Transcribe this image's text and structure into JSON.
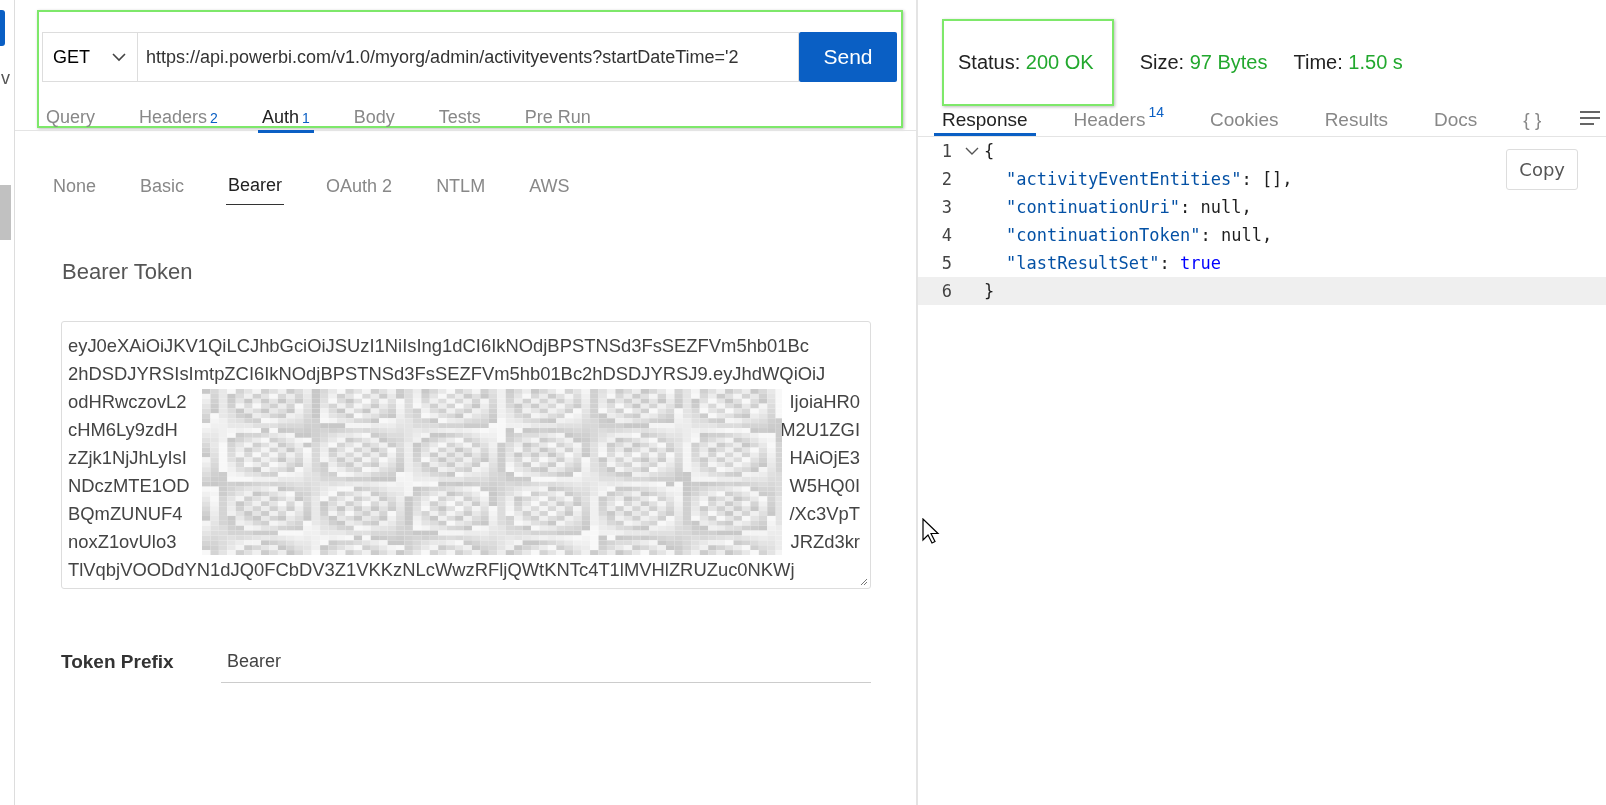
{
  "sidebar": {
    "text": "v"
  },
  "request": {
    "highlighted": true,
    "method": "GET",
    "url": "https://api.powerbi.com/v1.0/myorg/admin/activityevents?startDateTime='2",
    "send": "Send",
    "tabs": [
      {
        "label": "Query",
        "selected": false
      },
      {
        "label": "Headers",
        "badge": "2",
        "selected": false
      },
      {
        "label": "Auth",
        "badge": "1",
        "selected": true
      },
      {
        "label": "Body",
        "selected": false
      },
      {
        "label": "Tests",
        "selected": false
      },
      {
        "label": "Pre Run",
        "selected": false
      }
    ]
  },
  "auth": {
    "tabs": [
      {
        "label": "None",
        "selected": false
      },
      {
        "label": "Basic",
        "selected": false
      },
      {
        "label": "Bearer",
        "selected": true
      },
      {
        "label": "OAuth 2",
        "selected": false
      },
      {
        "label": "NTLM",
        "selected": false
      },
      {
        "label": "AWS",
        "selected": false
      }
    ],
    "title": "Bearer Token",
    "token_lines": [
      {
        "text": "eyJ0eXAiOiJKV1QiLCJhbGciOiJSUzI1NiIsIng1dCI6IkNOdjBPSTNSd3FsSEZFVm5hb01Bc"
      },
      {
        "text": "2hDSDJYRSIsImtpZCI6IkNOdjBPSTNSd3FsSEZFVm5hb01Bc2hDSDJYRSJ9.eyJhdWQiOiJ"
      },
      {
        "left": "odHRwczovL2",
        "right": "IjoiaHR0"
      },
      {
        "left": "cHM6Ly9zdH",
        "right": "M2U1ZGI"
      },
      {
        "left": "zZjk1NjJhLyIsI",
        "right": "HAiOjE3"
      },
      {
        "left": "NDczMTE1OD",
        "right": "W5HQ0I"
      },
      {
        "left": "BQmZUNUF4",
        "right": "/Xc3VpT"
      },
      {
        "left": "noxZ1ovUlo3",
        "right": "JRZd3kr"
      },
      {
        "text": "TlVqbjVOODdYN1dJQ0FCbDV3Z1VKKzNLcWwzRFljQWtKNTc4T1lMVHlZRUZuc0NKWj"
      }
    ],
    "prefix_label": "Token Prefix",
    "prefix_value": "Bearer"
  },
  "response": {
    "status": {
      "label": "Status:",
      "value": "200 OK",
      "highlighted": true
    },
    "size": {
      "label": "Size:",
      "value": "97 Bytes"
    },
    "time": {
      "label": "Time:",
      "value": "1.50 s"
    },
    "tabs": [
      {
        "label": "Response",
        "selected": true
      },
      {
        "label": "Headers",
        "badge": "14",
        "selected": false
      },
      {
        "label": "Cookies",
        "selected": false
      },
      {
        "label": "Results",
        "selected": false
      },
      {
        "label": "Docs",
        "selected": false
      },
      {
        "label": "{ }",
        "selected": false
      }
    ],
    "copy": "Copy",
    "code": [
      {
        "number": "1",
        "foldable": true,
        "current": false,
        "indented": false,
        "tokens": [
          {
            "kind": "punct",
            "text": "{"
          }
        ]
      },
      {
        "number": "2",
        "foldable": false,
        "current": false,
        "indented": true,
        "tokens": [
          {
            "kind": "key",
            "text": "\"activityEventEntities\""
          },
          {
            "kind": "punct",
            "text": ": [],"
          }
        ]
      },
      {
        "number": "3",
        "foldable": false,
        "current": false,
        "indented": true,
        "tokens": [
          {
            "kind": "key",
            "text": "\"continuationUri\""
          },
          {
            "kind": "punct",
            "text": ": null,"
          }
        ]
      },
      {
        "number": "4",
        "foldable": false,
        "current": false,
        "indented": true,
        "tokens": [
          {
            "kind": "key",
            "text": "\"continuationToken\""
          },
          {
            "kind": "punct",
            "text": ": null,"
          }
        ]
      },
      {
        "number": "5",
        "foldable": false,
        "current": false,
        "indented": true,
        "tokens": [
          {
            "kind": "key",
            "text": "\"lastResultSet\""
          },
          {
            "kind": "punct",
            "text": ": "
          },
          {
            "kind": "keyword",
            "text": "true"
          }
        ]
      },
      {
        "number": "6",
        "foldable": false,
        "current": true,
        "indented": false,
        "tokens": [
          {
            "kind": "punct",
            "text": "}"
          }
        ]
      }
    ]
  }
}
